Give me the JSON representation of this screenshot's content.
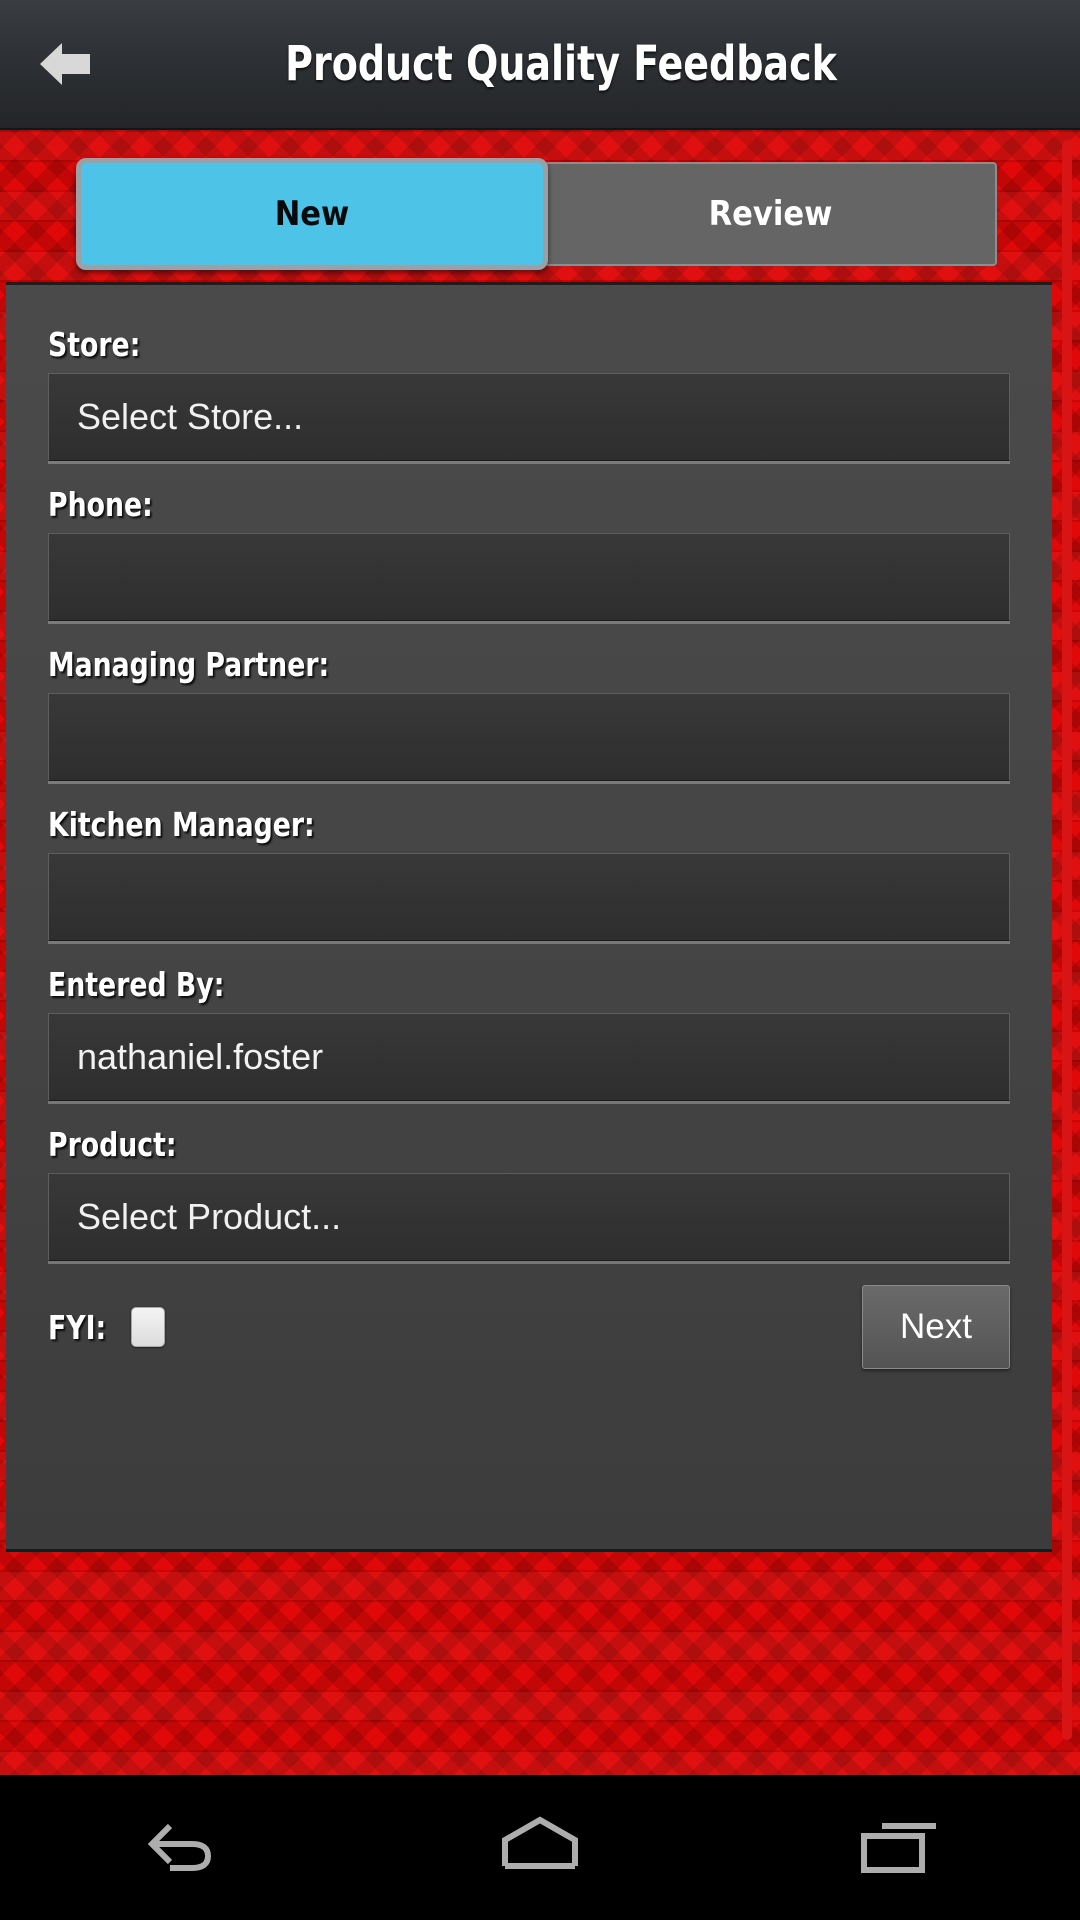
{
  "header": {
    "title": "Product Quality Feedback",
    "back_icon": "back-arrow-icon"
  },
  "tabs": [
    {
      "label": "New",
      "active": true
    },
    {
      "label": "Review",
      "active": false
    }
  ],
  "form": {
    "fields": [
      {
        "label": "Store:",
        "value": "Select Store...",
        "type": "select"
      },
      {
        "label": "Phone:",
        "value": "",
        "type": "text"
      },
      {
        "label": "Managing Partner:",
        "value": "",
        "type": "text"
      },
      {
        "label": "Kitchen Manager:",
        "value": "",
        "type": "text"
      },
      {
        "label": "Entered By:",
        "value": "nathaniel.foster",
        "type": "text"
      },
      {
        "label": "Product:",
        "value": "Select Product...",
        "type": "select"
      }
    ],
    "fyi_label": "FYI:",
    "fyi_checked": false,
    "next_label": "Next"
  },
  "navbar": {
    "back": "nav-back-icon",
    "home": "nav-home-icon",
    "recents": "nav-recents-icon"
  },
  "colors": {
    "accent_red": "#e00808",
    "tab_active": "#4ec3e8",
    "tab_inactive": "#656565",
    "panel": "#464646",
    "header": "#303337"
  }
}
